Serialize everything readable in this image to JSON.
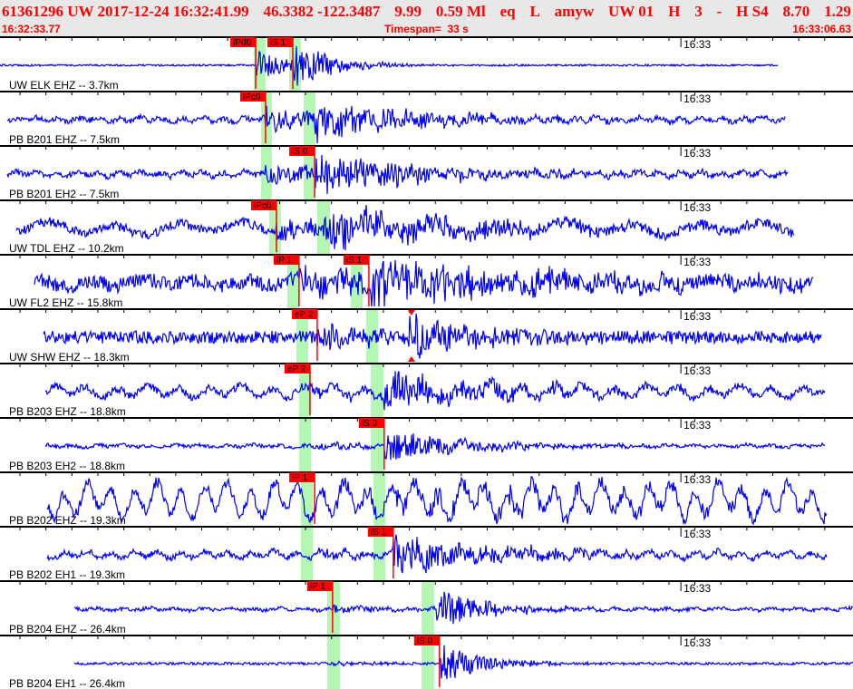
{
  "header": {
    "segments": [
      "61361296 UW 2017-12-24 16:32:41.99",
      "46.3382 -122.3487",
      "9.99",
      "0.59 Ml",
      "eq",
      "L",
      "amyw",
      "UW 01",
      "H",
      "3",
      "-",
      "H S4",
      "8.70",
      "1.29"
    ],
    "start_time": "16:32:33.77",
    "timespan": "Timespan=  33 s",
    "end_time": "16:33:06.63"
  },
  "time_axis": {
    "seconds_per_tick": 1,
    "span_seconds": 32.86,
    "minute_mark_seconds": 26.23,
    "minute_label": "16:33"
  },
  "colors": {
    "trace": "#0000ff",
    "pick": "#ff0000",
    "window": "#b3f7b3",
    "header_text": "#ff0000",
    "axis": "#000000"
  },
  "channels": [
    {
      "label": "UW ELK EHZ -- 3.7km",
      "t0": 0.0,
      "t1": 29.96,
      "windows": [
        [
          9.78,
          10.23
        ],
        [
          11.14,
          11.59
        ]
      ],
      "picks": [
        {
          "label": "iPd0",
          "t": 9.85
        },
        {
          "label": "iS 1",
          "t": 11.28
        }
      ]
    },
    {
      "label": "PB B201 EHZ -- 7.5km",
      "t0": 0.28,
      "t1": 30.24,
      "windows": [
        [
          10.06,
          10.47
        ],
        [
          11.7,
          12.15
        ]
      ],
      "picks": [
        {
          "label": "iPc0",
          "t": 10.23
        }
      ]
    },
    {
      "label": "PB B201 EH2 -- 7.5km",
      "t0": 0.28,
      "t1": 30.34,
      "windows": [
        [
          10.06,
          10.47
        ],
        [
          11.7,
          12.15
        ]
      ],
      "picks": [
        {
          "label": "iS 0",
          "t": 12.12
        }
      ]
    },
    {
      "label": "UW TDL EHZ -- 10.2km",
      "t0": 0.63,
      "t1": 30.59,
      "windows": [
        [
          10.37,
          10.82
        ],
        [
          12.22,
          12.71
        ]
      ],
      "picks": [
        {
          "label": "iPc0",
          "t": 10.65
        }
      ]
    },
    {
      "label": "UW FL2 EHZ -- 15.8km",
      "t0": 1.33,
      "t1": 31.32,
      "windows": [
        [
          11.07,
          11.52
        ],
        [
          13.51,
          13.97
        ]
      ],
      "picks": [
        {
          "label": "iP 1",
          "t": 11.52
        },
        {
          "label": "iS 1",
          "t": 14.21
        }
      ]
    },
    {
      "label": "UW SHW EHZ -- 18.3km",
      "t0": 1.68,
      "t1": 31.63,
      "windows": [
        [
          11.42,
          11.87
        ],
        [
          14.11,
          14.56
        ]
      ],
      "picks": [
        {
          "label": "eP 2",
          "t": 12.22
        }
      ],
      "amp_marker_t": 15.85
    },
    {
      "label": "PB B203 EHZ -- 18.8km",
      "t0": 1.75,
      "t1": 31.77,
      "windows": [
        [
          11.52,
          11.98
        ],
        [
          14.28,
          14.77
        ]
      ],
      "picks": [
        {
          "label": "eP 2",
          "t": 11.94
        }
      ]
    },
    {
      "label": "PB B203 EH2 -- 18.8km",
      "t0": 1.75,
      "t1": 31.77,
      "windows": [
        [
          11.52,
          11.98
        ],
        [
          14.28,
          14.77
        ]
      ],
      "picks": [
        {
          "label": "iS 0",
          "t": 14.8
        }
      ]
    },
    {
      "label": "PB B202 EHZ -- 19.3km",
      "t0": 1.82,
      "t1": 31.84,
      "windows": [
        [
          11.59,
          12.05
        ],
        [
          14.39,
          14.84
        ]
      ],
      "picks": [
        {
          "label": "iP 1",
          "t": 12.12
        }
      ]
    },
    {
      "label": "PB B202 EH1 -- 19.3km",
      "t0": 1.82,
      "t1": 31.84,
      "windows": [
        [
          11.59,
          12.05
        ],
        [
          14.39,
          14.84
        ]
      ],
      "picks": [
        {
          "label": "iS 1",
          "t": 15.15
        }
      ]
    },
    {
      "label": "PB B204 EHZ -- 26.4km",
      "t0": 2.86,
      "t1": 32.86,
      "windows": [
        [
          12.6,
          13.09
        ],
        [
          16.24,
          16.72
        ]
      ],
      "picks": [
        {
          "label": "iP 1",
          "t": 12.81
        }
      ]
    },
    {
      "label": "PB B204 EH1 -- 26.4km",
      "t0": 2.86,
      "t1": 32.86,
      "windows": [
        [
          12.6,
          13.09
        ],
        [
          16.24,
          16.72
        ]
      ],
      "picks": [
        {
          "label": "iS 0",
          "t": 16.93
        }
      ]
    }
  ]
}
